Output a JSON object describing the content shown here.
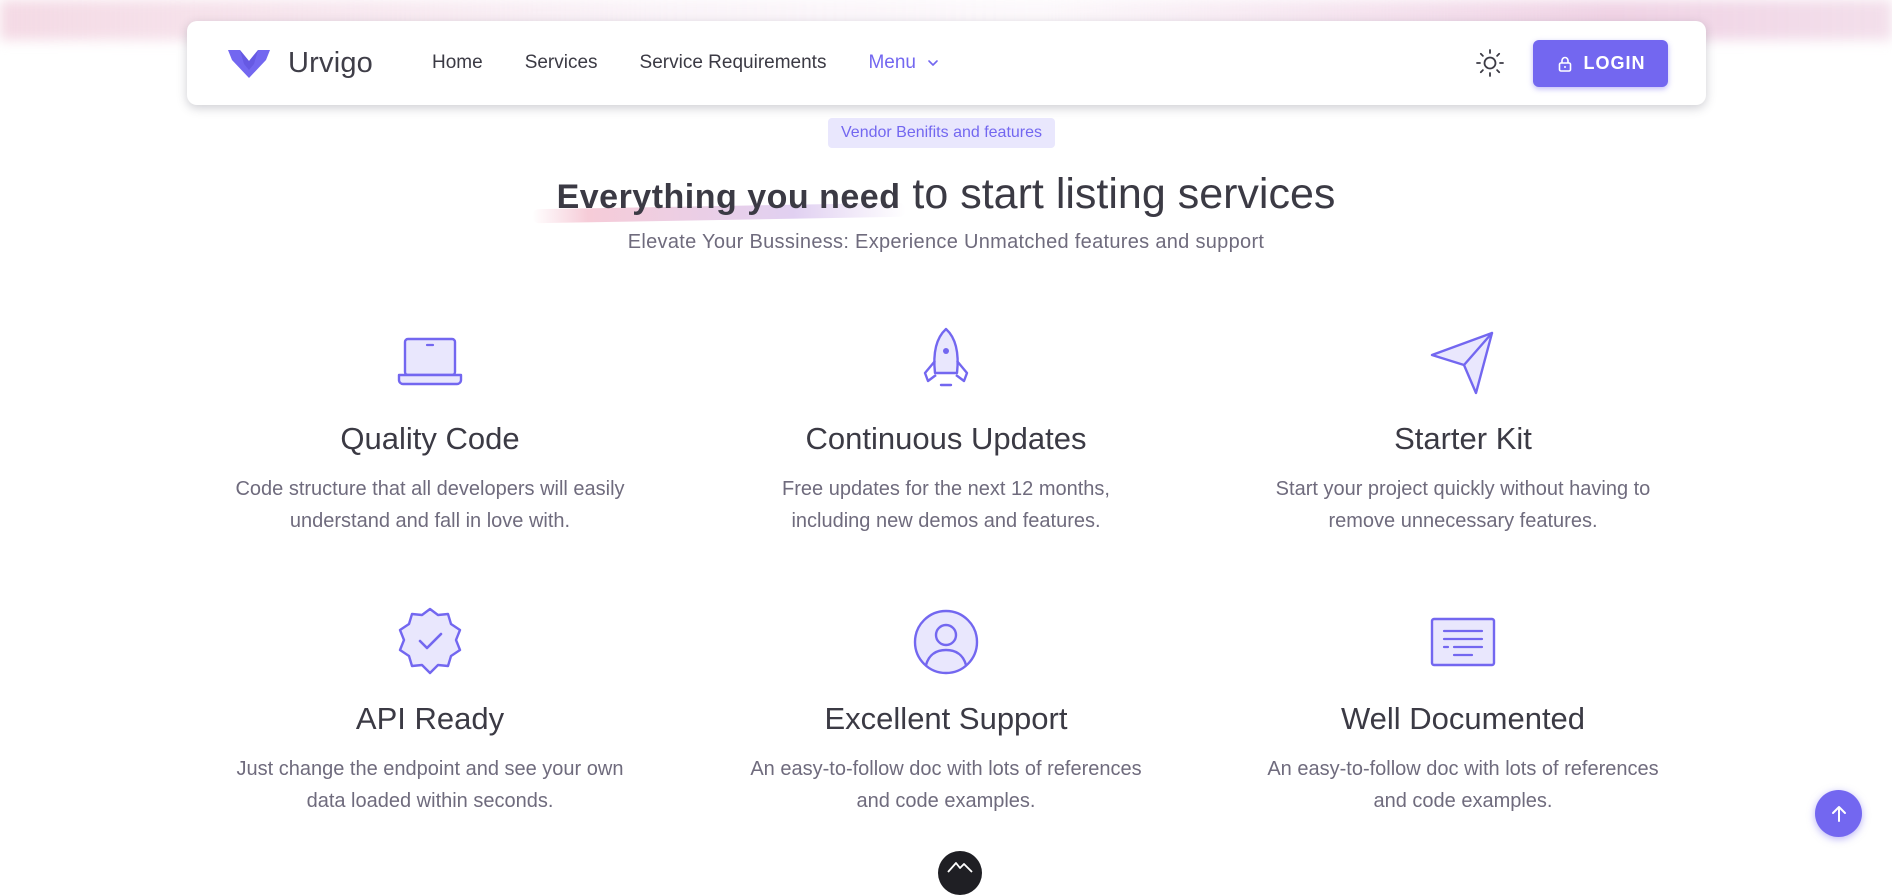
{
  "brand": {
    "name": "Urvigo",
    "color": "#7367f0"
  },
  "nav": {
    "links": [
      "Home",
      "Services",
      "Service Requirements"
    ],
    "menu_label": "Menu",
    "theme_icon": "sun-icon"
  },
  "login": {
    "label": "LOGIN",
    "icon": "lock-icon"
  },
  "section": {
    "badge": "Vendor Benifits and features",
    "headline_strong": "Everything you need",
    "headline_rest": " to start listing services",
    "subhead": "Elevate Your Bussiness: Experience Unmatched features and support"
  },
  "features": [
    {
      "icon": "laptop-icon",
      "title": "Quality Code",
      "desc": "Code structure that all developers will easily understand and fall in love with."
    },
    {
      "icon": "rocket-icon",
      "title": "Continuous Updates",
      "desc": "Free updates for the next 12 months, including new demos and features."
    },
    {
      "icon": "paper-plane-icon",
      "title": "Starter Kit",
      "desc": "Start your project quickly without having to remove unnecessary features."
    },
    {
      "icon": "badge-check-icon",
      "title": "API Ready",
      "desc": "Just change the endpoint and see your own data loaded within seconds."
    },
    {
      "icon": "user-circle-icon",
      "title": "Excellent Support",
      "desc": "An easy-to-follow doc with lots of references and code examples."
    },
    {
      "icon": "document-icon",
      "title": "Well Documented",
      "desc": "An easy-to-follow doc with lots of references and code examples."
    }
  ],
  "colors": {
    "primary": "#7367f0",
    "primary_light": "#e9e7fd",
    "text": "#3b3a44",
    "muted": "#6f6b7d"
  }
}
